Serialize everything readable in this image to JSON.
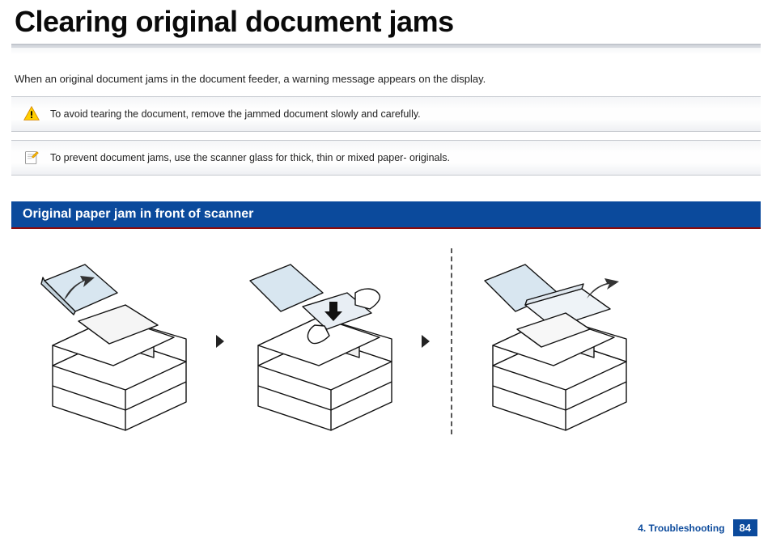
{
  "title": "Clearing original document jams",
  "intro": "When an original document jams in the document feeder, a warning message appears on the display.",
  "warning_box": {
    "text": "To avoid tearing the document, remove the jammed document slowly and carefully."
  },
  "note_box": {
    "text": "To prevent document jams, use the scanner glass for thick, thin or mixed paper- originals."
  },
  "section_heading": "Original paper jam in front of scanner",
  "footer": {
    "chapter": "4. Troubleshooting",
    "page": "84"
  }
}
